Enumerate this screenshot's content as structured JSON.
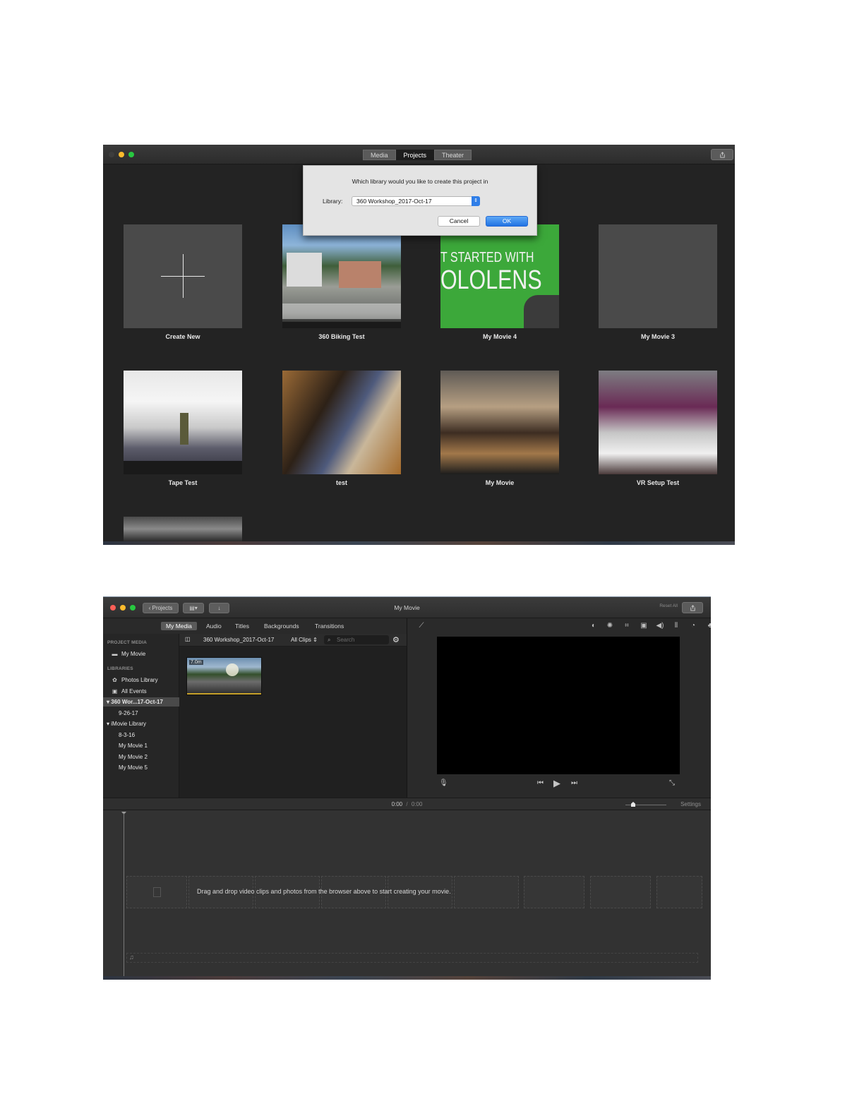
{
  "window1": {
    "tabs": [
      "Media",
      "Projects",
      "Theater"
    ],
    "active_tab": "Projects",
    "dialog": {
      "question": "Which library would you like to create this project in",
      "library_label": "Library:",
      "library_value": "360 Workshop_2017-Oct-17",
      "cancel_label": "Cancel",
      "ok_label": "OK"
    },
    "projects": [
      {
        "label": "Create New",
        "thumb": "plus-icon"
      },
      {
        "label": "360 Biking Test",
        "thumb": "street-panorama"
      },
      {
        "label": "My Movie 4",
        "thumb": "green-screen",
        "overlay_line1": "T STARTED WITH",
        "overlay_line2": "OLOLENS"
      },
      {
        "label": "My Movie 3",
        "thumb": "empty"
      },
      {
        "label": "Tape Test",
        "thumb": "office-panorama"
      },
      {
        "label": "test",
        "thumb": "blurry-room"
      },
      {
        "label": "My Movie",
        "thumb": "studio-guitars"
      },
      {
        "label": "VR Setup Test",
        "thumb": "purple-room"
      }
    ]
  },
  "window2": {
    "title": "My Movie",
    "back_label": "Projects",
    "media_tabs": [
      "My Media",
      "Audio",
      "Titles",
      "Backgrounds",
      "Transitions"
    ],
    "active_media_tab": "My Media",
    "sidebar": {
      "project_media_head": "PROJECT MEDIA",
      "project_item": "My Movie",
      "libraries_head": "LIBRARIES",
      "photos": "Photos Library",
      "all_events": "All Events",
      "lib1": "360 Wor...17-Oct-17",
      "lib1_event": "9-26-17",
      "lib2": "iMovie Library",
      "lib2_items": [
        "8-3-16",
        "My Movie 1",
        "My Movie 2",
        "My Movie 5"
      ]
    },
    "browser": {
      "library_name": "360 Workshop_2017-Oct-17",
      "filter": "All Clips",
      "search_placeholder": "Search",
      "clip_duration": "7.0m"
    },
    "viewer": {
      "reset_label": "Reset All"
    },
    "timeline": {
      "current_time": "0:00",
      "separator": "/",
      "total_time": "0:00",
      "settings_label": "Settings",
      "drop_hint": "Drag and drop video clips and photos from the browser above to start creating your movie."
    }
  },
  "colors": {
    "window_bg": "#232323",
    "accent_blue": "#2f7ee8",
    "close": "#fc5f57",
    "minimize": "#fdbb2d",
    "zoom": "#28c840"
  }
}
